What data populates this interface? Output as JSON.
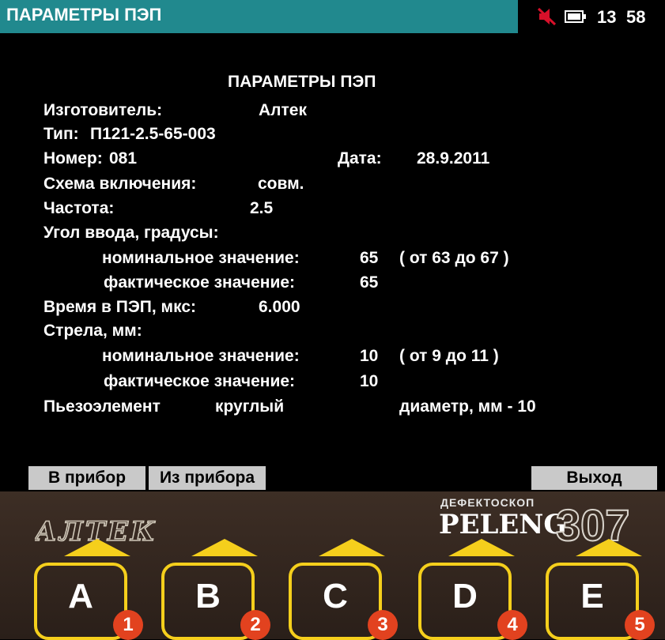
{
  "titlebar": {
    "title": "ПАРАМЕТРЫ ПЭП",
    "sound_icon": "speaker-muted-icon",
    "battery_icon": "battery-icon",
    "clock_hours": "13",
    "clock_minutes": "58"
  },
  "panel": {
    "heading": "ПАРАМЕТРЫ ПЭП",
    "manufacturer_label": "Изготовитель:",
    "manufacturer_value": "Алтек",
    "type_label": "Тип:",
    "type_value": "П121-2.5-65-003",
    "number_label": "Номер:",
    "number_value": "081",
    "date_label": "Дата:",
    "date_value": "28.9.2011",
    "scheme_label": "Схема включения:",
    "scheme_value": "совм.",
    "frequency_label": "Частота:",
    "frequency_value": "2.5",
    "angle_label": "Угол ввода, градусы:",
    "angle_nominal_label": "номинальное значение:",
    "angle_nominal_value": "65",
    "angle_nominal_range": "( от 63 до 67 )",
    "angle_actual_label": "фактическое значение:",
    "angle_actual_value": "65",
    "time_label": "Время в ПЭП, мкс:",
    "time_value": "6.000",
    "arrow_label": "Стрела, мм:",
    "arrow_nominal_label": "номинальное значение:",
    "arrow_nominal_value": "10",
    "arrow_nominal_range": "( от  9 до 11 )",
    "arrow_actual_label": "фактическое значение:",
    "arrow_actual_value": "10",
    "piezo_label": "Пьезоэлемент",
    "piezo_shape": "круглый",
    "piezo_diameter": "диаметр, мм - 10"
  },
  "softkeys": {
    "to_device": "В прибор",
    "from_device": "Из прибора",
    "exit": "Выход"
  },
  "bezel": {
    "brand_logo": "АЛТЕК",
    "device_caption": "ДЕФЕКТОСКОП",
    "device_name": "PELENG",
    "device_model": "307",
    "keys": [
      {
        "letter": "A",
        "number": "1"
      },
      {
        "letter": "B",
        "number": "2"
      },
      {
        "letter": "C",
        "number": "3"
      },
      {
        "letter": "D",
        "number": "4"
      },
      {
        "letter": "E",
        "number": "5"
      }
    ]
  },
  "colors": {
    "title_bar": "#21898e",
    "softkey_bg": "#c9c9c9",
    "key_outline": "#f5cf1c",
    "key_badge": "#e2421f",
    "mute_icon": "#d8102a"
  }
}
